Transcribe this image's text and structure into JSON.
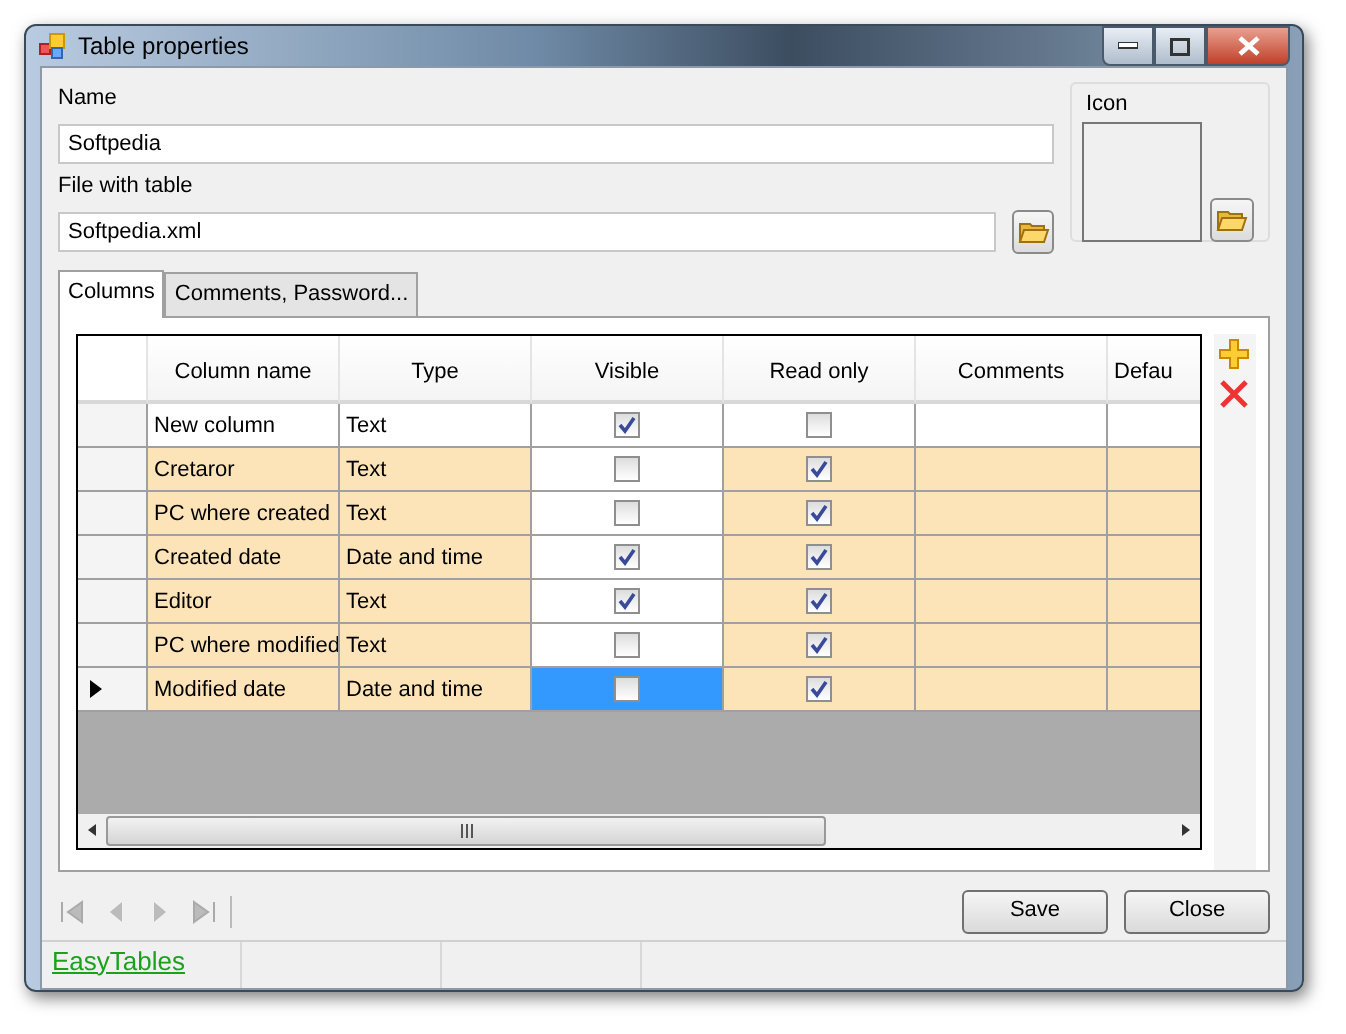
{
  "window": {
    "title": "Table properties"
  },
  "name_field": {
    "label": "Name",
    "value": "Softpedia"
  },
  "file_field": {
    "label": "File with table",
    "value": "Softpedia.xml"
  },
  "icon_group": {
    "label": "Icon"
  },
  "tabs": [
    {
      "label": "Columns",
      "selected": true
    },
    {
      "label": "Comments, Password...",
      "selected": false
    }
  ],
  "table": {
    "columns": [
      "Column name",
      "Type",
      "Visible",
      "Read only",
      "Comments",
      "Defau"
    ],
    "rows": [
      {
        "name": "New column",
        "type": "Text",
        "visible": true,
        "read_only": false,
        "highlighted": false,
        "current": false
      },
      {
        "name": "Cretaror",
        "type": "Text",
        "visible": false,
        "read_only": true,
        "highlighted": true,
        "current": false
      },
      {
        "name": "PC where created",
        "type": "Text",
        "visible": false,
        "read_only": true,
        "highlighted": true,
        "current": false
      },
      {
        "name": "Created date",
        "type": "Date and time",
        "visible": true,
        "read_only": true,
        "highlighted": true,
        "current": false
      },
      {
        "name": "Editor",
        "type": "Text",
        "visible": true,
        "read_only": true,
        "highlighted": true,
        "current": false
      },
      {
        "name": "PC where modified",
        "type": "Text",
        "visible": false,
        "read_only": true,
        "highlighted": true,
        "current": false
      },
      {
        "name": "Modified date",
        "type": "Date and time",
        "visible": false,
        "read_only": true,
        "highlighted": true,
        "current": true
      }
    ]
  },
  "buttons": [
    "Save",
    "Close"
  ],
  "status_bar": {
    "text": "EasyTables"
  }
}
